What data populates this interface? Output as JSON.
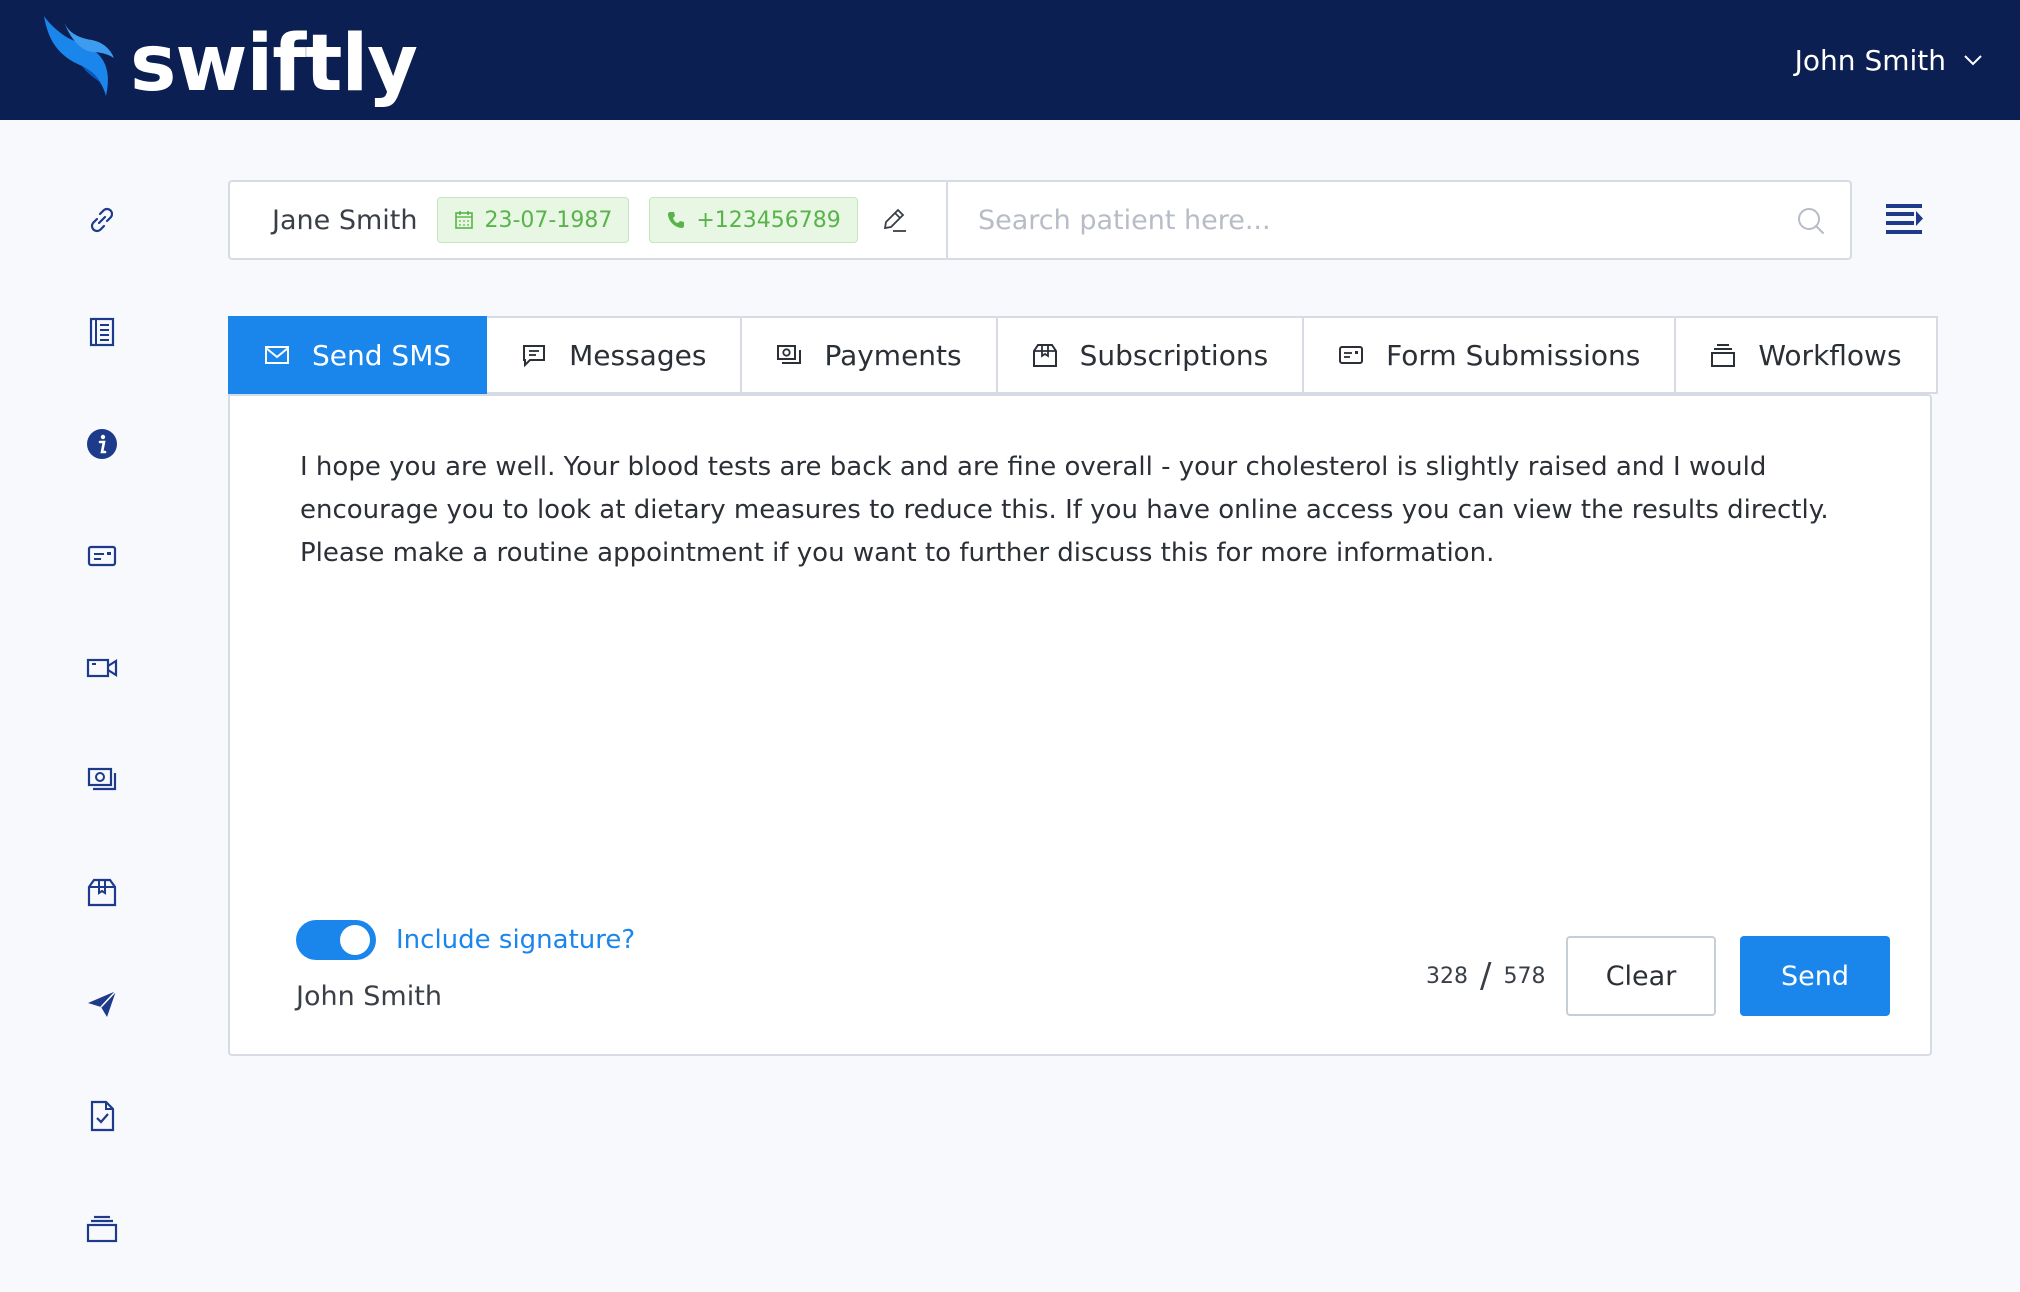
{
  "header": {
    "brand": "swiftly",
    "user_name": "John Smith"
  },
  "sidebar": {
    "items": [
      {
        "icon": "link-icon"
      },
      {
        "icon": "notebook-icon"
      },
      {
        "icon": "info-icon"
      },
      {
        "icon": "id-card-icon"
      },
      {
        "icon": "video-icon"
      },
      {
        "icon": "payment-icon"
      },
      {
        "icon": "box-icon"
      },
      {
        "icon": "send-icon"
      },
      {
        "icon": "document-check-icon"
      },
      {
        "icon": "stack-icon"
      }
    ]
  },
  "patient": {
    "name": "Jane Smith",
    "dob": "23-07-1987",
    "phone": "+123456789"
  },
  "search": {
    "placeholder": "Search patient here...",
    "value": ""
  },
  "tabs": [
    {
      "label": "Send SMS",
      "icon": "envelope-icon",
      "active": true
    },
    {
      "label": "Messages",
      "icon": "chat-icon",
      "active": false
    },
    {
      "label": "Payments",
      "icon": "payment-icon",
      "active": false
    },
    {
      "label": "Subscriptions",
      "icon": "box-icon",
      "active": false
    },
    {
      "label": "Form Submissions",
      "icon": "form-icon",
      "active": false
    },
    {
      "label": "Workflows",
      "icon": "stack-icon",
      "active": false
    }
  ],
  "composer": {
    "message": "I hope you are well. Your blood tests are back and are fine overall - your cholesterol is slightly raised and I would encourage you to look at dietary measures to reduce this. If you have online access you can view the results directly. Please make a routine appointment if you want to further discuss this for more information.",
    "signature_label": "Include signature?",
    "signature_enabled": true,
    "signature_name": "John Smith",
    "char_count": "328",
    "char_limit": "578",
    "clear_label": "Clear",
    "send_label": "Send"
  },
  "colors": {
    "header_bg": "#0c1f52",
    "accent": "#1a86ec",
    "chip_green": "#58b44a",
    "chip_bg": "#e8f6e4",
    "sidebar_icon": "#1e3a8a"
  }
}
